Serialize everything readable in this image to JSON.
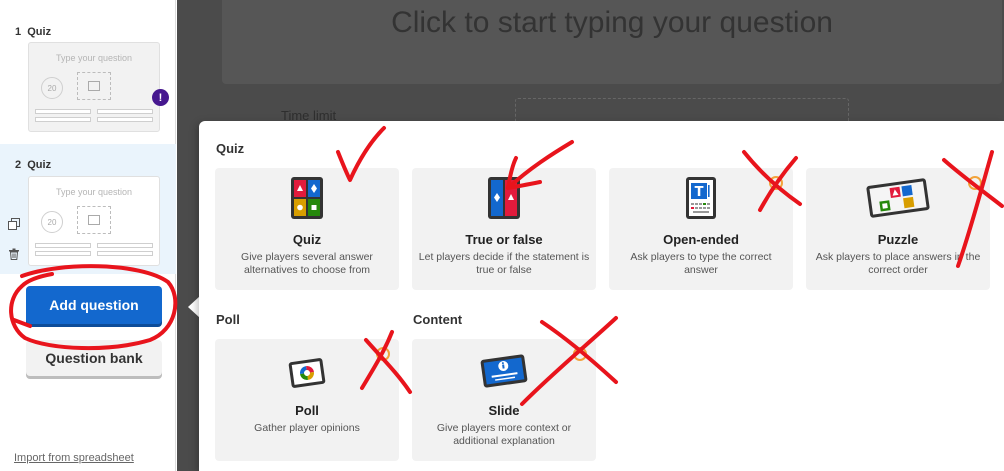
{
  "sidebar": {
    "slides": [
      {
        "number": "1",
        "type": "Quiz",
        "placeholder": "Type your question",
        "timer": "20",
        "has_warning": true
      },
      {
        "number": "2",
        "type": "Quiz",
        "placeholder": "Type your question",
        "timer": "20",
        "selected": true
      }
    ],
    "warning_symbol": "!",
    "add_question_label": "Add question",
    "question_bank_label": "Question bank",
    "import_label": "Import from spreadsheet"
  },
  "editor": {
    "question_placeholder": "Click to start typing your question",
    "time_limit_label": "Time limit"
  },
  "modal": {
    "sections": {
      "quiz": "Quiz",
      "poll": "Poll",
      "content": "Content"
    },
    "cards": {
      "quiz": {
        "title": "Quiz",
        "desc": "Give players several answer alternatives to choose from"
      },
      "true_false": {
        "title": "True or false",
        "desc": "Let players decide if the statement is true or false"
      },
      "open_ended": {
        "title": "Open-ended",
        "desc": "Ask players to type the correct answer"
      },
      "puzzle": {
        "title": "Puzzle",
        "desc": "Ask players to place answers in the correct order"
      },
      "poll": {
        "title": "Poll",
        "desc": "Gather player opinions"
      },
      "slide": {
        "title": "Slide",
        "desc": "Give players more context or additional explanation"
      }
    }
  },
  "colors": {
    "kahoot_red": "#e21b3c",
    "kahoot_blue": "#1368ce",
    "kahoot_yellow": "#d89e00",
    "kahoot_green": "#26890c",
    "annotation_red": "#e8141c",
    "premium_orange": "#f2a33a",
    "warning_purple": "#46178f"
  }
}
